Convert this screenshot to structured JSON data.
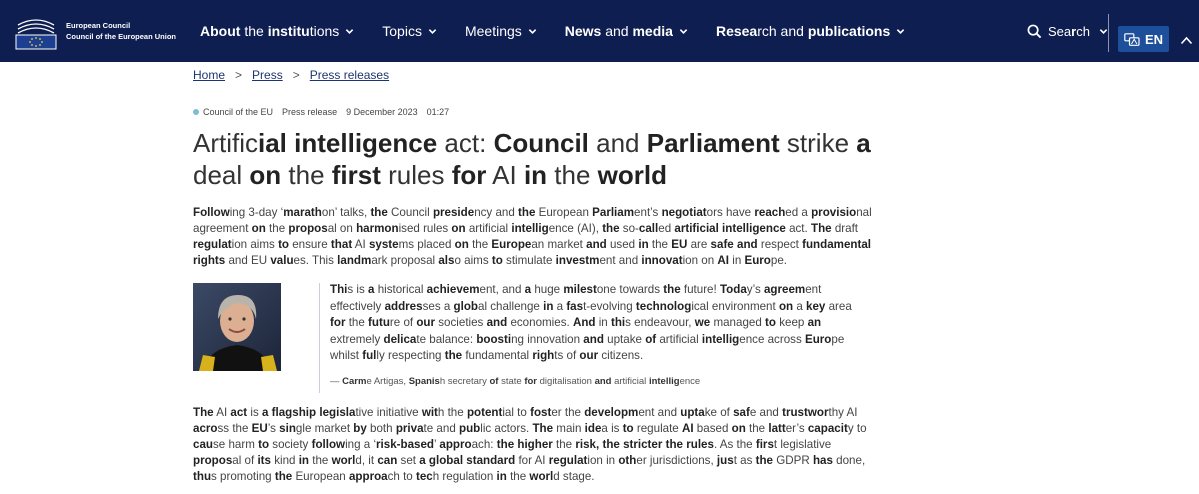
{
  "header": {
    "logo_line1": "European Council",
    "logo_line2": "Council of the European Union",
    "nav": [
      {
        "label_html": "<b>About</b> the <b>institu</b>tions"
      },
      {
        "label_html": "Topics"
      },
      {
        "label_html": "Meetings"
      },
      {
        "label_html": "<b>News</b> and <b>media</b>"
      },
      {
        "label_html": "<b>Resea</b>rch and <b>publications</b>"
      }
    ],
    "search_label_html": "Sea<b>r</b>ch",
    "language": "EN",
    "colors": {
      "bar": "#0e1e50",
      "lang_button": "#1e4f9a"
    }
  },
  "breadcrumb": {
    "items": [
      "Home",
      "Press",
      "Press releases"
    ],
    "separator": ">"
  },
  "meta": {
    "source": "Council of the EU",
    "type": "Press release",
    "date": "9 December 2023",
    "time": "01:27"
  },
  "article": {
    "title_html": "Artific<b>ial</b> <b>intelligence</b> act: <b>Council</b> and <b>Parliament</b> strike <b>a</b> deal <b>on</b> the <b>first</b> rules <b>for</b> AI <b>in</b> the <b>world</b>",
    "para1_html": "<b>Follow</b>ing 3-day ‘<b>marath</b>on’ talks, <b>the</b> Council <b>preside</b>ncy and <b>the</b> European <b>Parliam</b>ent’s <b>negotiat</b>ors have <b>reach</b>ed a <b>provisio</b>nal agreement <b>on</b> the <b>propos</b>al on <b>harmon</b>ised rules <b>on</b> artificial <b>intellig</b>ence (AI), <b>the</b> so-<b>call</b>ed <b>artificial intelligence</b> act. <b>The</b> draft <b>regulat</b>ion aims <b>to</b> ensure <b>that</b> AI <b>syste</b>ms placed <b>on</b> the <b>Europe</b>an market <b>and</b> used <b>in</b> the <b>EU</b> are <b>safe</b> <b>and</b> respect <b>fundamental rights</b> and EU <b>valu</b>es. This <b>landm</b>ark proposal <b>als</b>o aims <b>to</b> stimulate <b>investm</b>ent and <b>innovat</b>ion on <b>AI</b> in <b>Euro</b>pe.",
    "quote_html": "<b>Thi</b>s is <b>a</b> historical <b>achievem</b>ent, and <b>a</b> huge <b>milest</b>one towards <b>the</b> future! <b>Toda</b>y’s <b>agreem</b>ent effectively <b>addres</b>ses a <b>glob</b>al challenge <b>in</b> a <b>fas</b>t-evolving <b>technolog</b>ical environment <b>on</b> a <b>key</b> area <b>for</b> the <b>futu</b>re of <b>our</b> societies <b>and</b> economies. <b>And</b> in <b>thi</b>s endeavour, <b>we</b> managed <b>to</b> keep <b>an</b> extremely <b>delica</b>te balance: <b>boosti</b>ng innovation <b>and</b> uptake <b>of</b> artificial <b>intellig</b>ence across <b>Euro</b>pe whilst <b>ful</b>ly respecting <b>the</b> fundamental <b>righ</b>ts of <b>our</b> citizens.",
    "quote_attribution_html": "— <b>Carm</b>e Artigas, <b>Spanis</b>h secretary <b>of</b> state <b>for</b> digitalisation <b>and</b> artificial <b>intellig</b>ence",
    "para3_html": "<b>The</b> AI <b>act</b> is <b>a flagship</b> <b>legisla</b>tive initiative <b>wit</b>h the <b>potent</b>ial to <b>fost</b>er the <b>developm</b>ent and <b>upta</b>ke of <b>saf</b>e and <b>trustwor</b>thy AI <b>acro</b>ss the <b>EU</b>’s <b>sin</b>gle market <b>by</b> both <b>priva</b>te and <b>pub</b>lic actors. <b>The</b> main <b>ide</b>a is <b>to</b> regulate <b>AI</b> based <b>on</b> the <b>latt</b>er’s <b>capacit</b>y to <b>cau</b>se harm <b>to</b> society <b>follow</b>ing a ‘<b>risk-based</b>’ <b>appro</b>ach: <b>the higher</b> the <b>risk,</b> <b>the stricter</b> <b>the rules</b>. As the <b>firs</b>t legislative <b>propos</b>al of <b>its</b> kind <b>in</b> the <b>worl</b>d, it <b>can</b> set <b>a glob</b><b>al standard</b> for AI <b>regulat</b>ion in <b>oth</b>er jurisdictions, <b>jus</b>t as <b>the</b> GDPR <b>has</b> done, <b>thu</b>s promoting <b>the</b> European <b>approa</b>ch to <b>tec</b>h regulation <b>in</b> the <b>worl</b>d stage."
  }
}
